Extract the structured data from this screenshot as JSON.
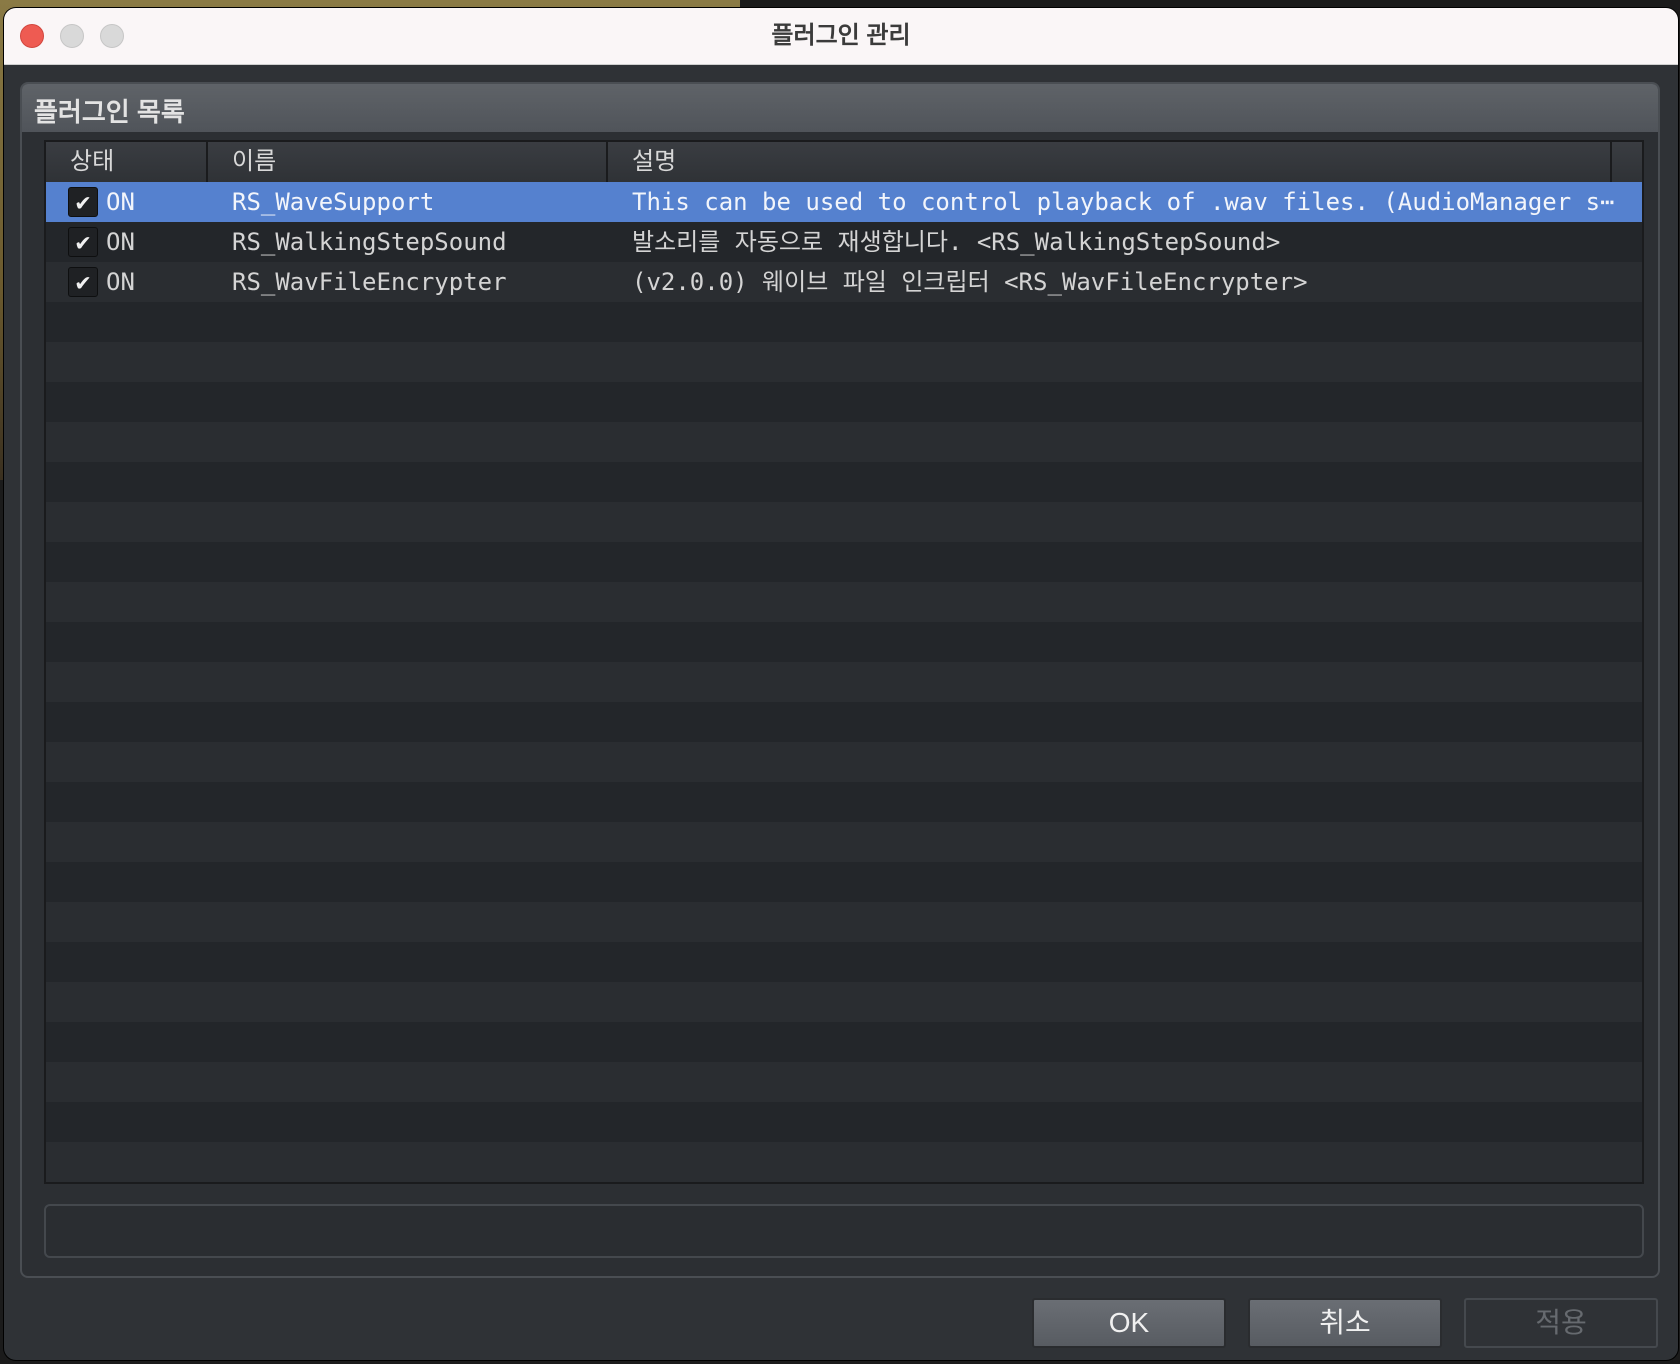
{
  "window": {
    "title": "플러그인 관리"
  },
  "group": {
    "title": "플러그인 목록"
  },
  "table": {
    "columns": [
      "상태",
      "이름",
      "설명"
    ],
    "rows": [
      {
        "checked": true,
        "status": "ON",
        "name": "RS_WaveSupport",
        "description": "This can be used to control playback of .wav files. (AudioManager s⋯"
      },
      {
        "checked": true,
        "status": "ON",
        "name": "RS_WalkingStepSound",
        "description": "발소리를 자동으로 재생합니다. <RS_WalkingStepSound>"
      },
      {
        "checked": true,
        "status": "ON",
        "name": "RS_WavFileEncrypter",
        "description": "(v2.0.0) 웨이브 파일 인크립터 <RS_WavFileEncrypter>"
      }
    ],
    "check_glyph": "✔",
    "selected_row": 0
  },
  "buttons": {
    "ok": "OK",
    "cancel": "취소",
    "apply": "적용"
  },
  "colors": {
    "selection": "#5581cf",
    "close_button": "#ee5b52"
  }
}
